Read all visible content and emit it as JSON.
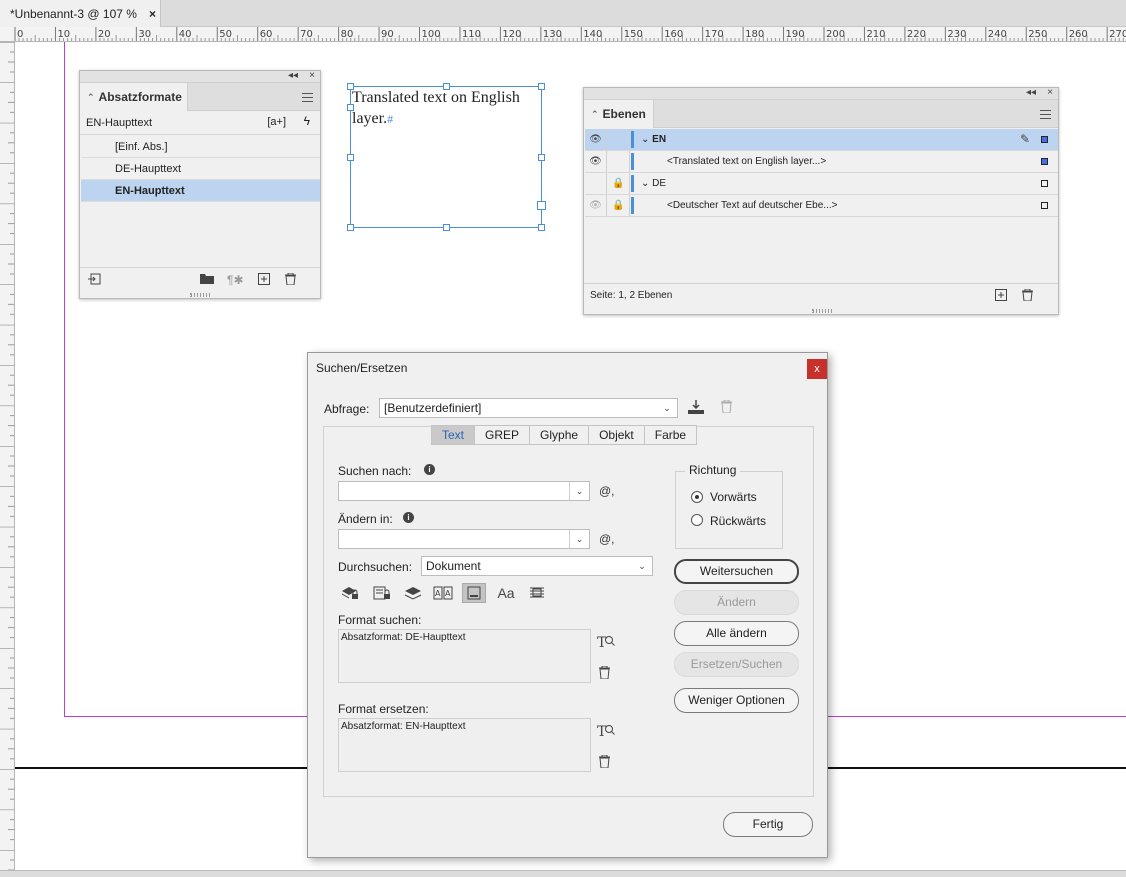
{
  "document": {
    "tab_title": "*Unbenannt-3 @ 107 %",
    "tab_close": "×",
    "ruler_ticks": [
      "0",
      "10",
      "20",
      "30",
      "40",
      "50",
      "60",
      "70",
      "80",
      "90",
      "100",
      "110",
      "120",
      "130",
      "140",
      "150",
      "160",
      "170",
      "180",
      "190",
      "200",
      "210",
      "220",
      "230",
      "240",
      "250",
      "260",
      "270"
    ]
  },
  "text_frame": {
    "line1": "Translated text on English",
    "line2": "layer.",
    "pilcrow": "#"
  },
  "paragraph_styles_panel": {
    "title": "Absatzformate",
    "collapse": "◂◂",
    "close": "×",
    "current_style": "EN-Haupttext",
    "new_style_btn": "[a+]",
    "clear_overrides_btn": "ϟ",
    "items": [
      {
        "label": "[Einf. Abs.]",
        "selected": false
      },
      {
        "label": "DE-Haupttext",
        "selected": false
      },
      {
        "label": "EN-Haupttext",
        "selected": true
      }
    ],
    "footer_icons": [
      "load-styles-icon",
      "folder-icon",
      "clear-override-icon",
      "new-style-icon",
      "trash-icon"
    ]
  },
  "layers_panel": {
    "title": "Ebenen",
    "collapse": "◂◂",
    "close": "×",
    "layers": [
      {
        "name": "EN",
        "type": "layer",
        "visible": true,
        "locked": false,
        "selected": true,
        "expanded": true,
        "color": "#4a90d9",
        "square_filled": true
      },
      {
        "name": "<Translated text on English layer...>",
        "type": "item",
        "visible": true,
        "locked": false,
        "selected": false,
        "color": "#4a90d9",
        "square_filled": true
      },
      {
        "name": "DE",
        "type": "layer",
        "visible": false,
        "locked": true,
        "selected": false,
        "expanded": true,
        "color": "#4a90d9",
        "square_filled": false
      },
      {
        "name": "<Deutscher Text auf deutscher Ebe...>",
        "type": "item",
        "visible": "dim",
        "locked": true,
        "selected": false,
        "color": "#4a90d9",
        "square_filled": false
      }
    ],
    "status": "Seite: 1, 2 Ebenen"
  },
  "find_replace": {
    "title": "Suchen/Ersetzen",
    "close": "x",
    "query_label": "Abfrage:",
    "query_value": "[Benutzerdefiniert]",
    "tabs": [
      "Text",
      "GREP",
      "Glyphe",
      "Objekt",
      "Farbe"
    ],
    "active_tab": "Text",
    "find_label": "Suchen nach:",
    "find_value": "",
    "change_label": "Ändern in:",
    "change_value": "",
    "special_char": "@,",
    "search_label": "Durchsuchen:",
    "search_value": "Dokument",
    "format_find_label": "Format suchen:",
    "format_find_value": "Absatzformat: DE-Haupttext",
    "format_replace_label": "Format ersetzen:",
    "format_replace_value": "Absatzformat: EN-Haupttext",
    "direction_title": "Richtung",
    "direction_forward": "Vorwärts",
    "direction_backward": "Rückwärts",
    "direction_selected": "forward",
    "buttons": {
      "find_next": "Weitersuchen",
      "change": "Ändern",
      "change_all": "Alle ändern",
      "change_find": "Ersetzen/Suchen",
      "fewer_options": "Weniger Optionen",
      "done": "Fertig"
    },
    "option_icons": [
      "locked-layers-icon",
      "locked-stories-icon",
      "hidden-layers-icon",
      "master-pages-icon",
      "footnotes-icon",
      "case-sensitive-icon",
      "whole-word-icon"
    ],
    "active_option": "footnotes-icon",
    "info_glyph": "i",
    "case_glyph": "Aa"
  }
}
